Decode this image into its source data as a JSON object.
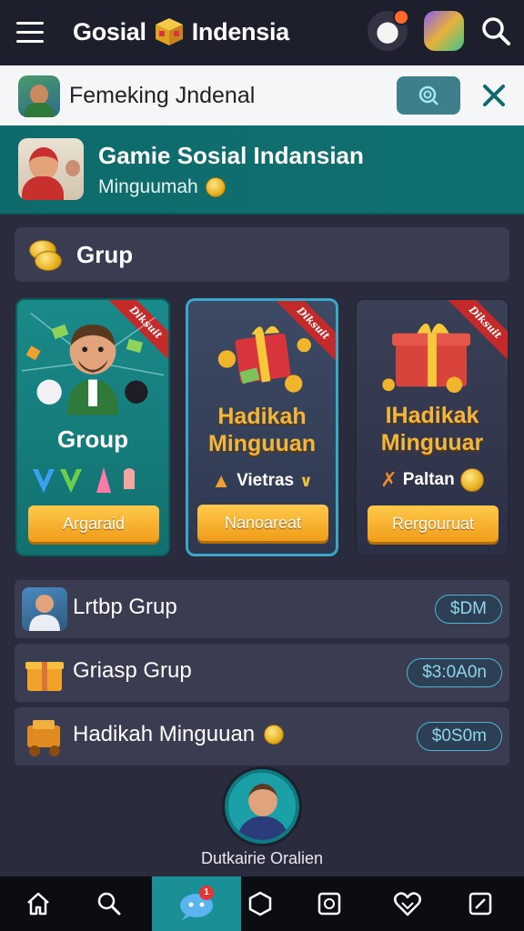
{
  "header": {
    "title_left": "Gosial",
    "title_right": "Indensia"
  },
  "search": {
    "value": "Femeking Jndenal"
  },
  "group_header": {
    "title": "Gamie Sosial Indansian",
    "subtitle": "Minguumah"
  },
  "section": {
    "title": "Grup"
  },
  "cards": [
    {
      "ribbon": "Diksuit",
      "title": "Group",
      "extra": "",
      "button": "Argaraid"
    },
    {
      "ribbon": "Diksuit",
      "title_line1": "Hadikah",
      "title_line2": "Minguuan",
      "extra": "Vietras",
      "button": "Nanoareat"
    },
    {
      "ribbon": "Diksuit",
      "title_line1": "IHadikak",
      "title_line2": "Minguuar",
      "extra": "Paltan",
      "button": "Rergouruat"
    }
  ],
  "list": [
    {
      "label": "Lrtbp Grup",
      "pill": "$DM"
    },
    {
      "label": "Griasp Grup",
      "pill": "$3:0A0n"
    },
    {
      "label": "Hadikah Minguuan",
      "pill": "$0S0m"
    }
  ],
  "profile": {
    "label": "Dutkairie Oralien"
  },
  "nav": {
    "badge": "1",
    "items": [
      "home-icon",
      "search-icon",
      "chat-icon",
      "hexagon-icon",
      "square-circle-icon",
      "heart-icon",
      "edit-icon"
    ]
  },
  "colors": {
    "background": "#2a2c3e",
    "teal": "#107070",
    "accent_orange": "#f09d1a",
    "pill_blue": "#4fb3d0"
  }
}
